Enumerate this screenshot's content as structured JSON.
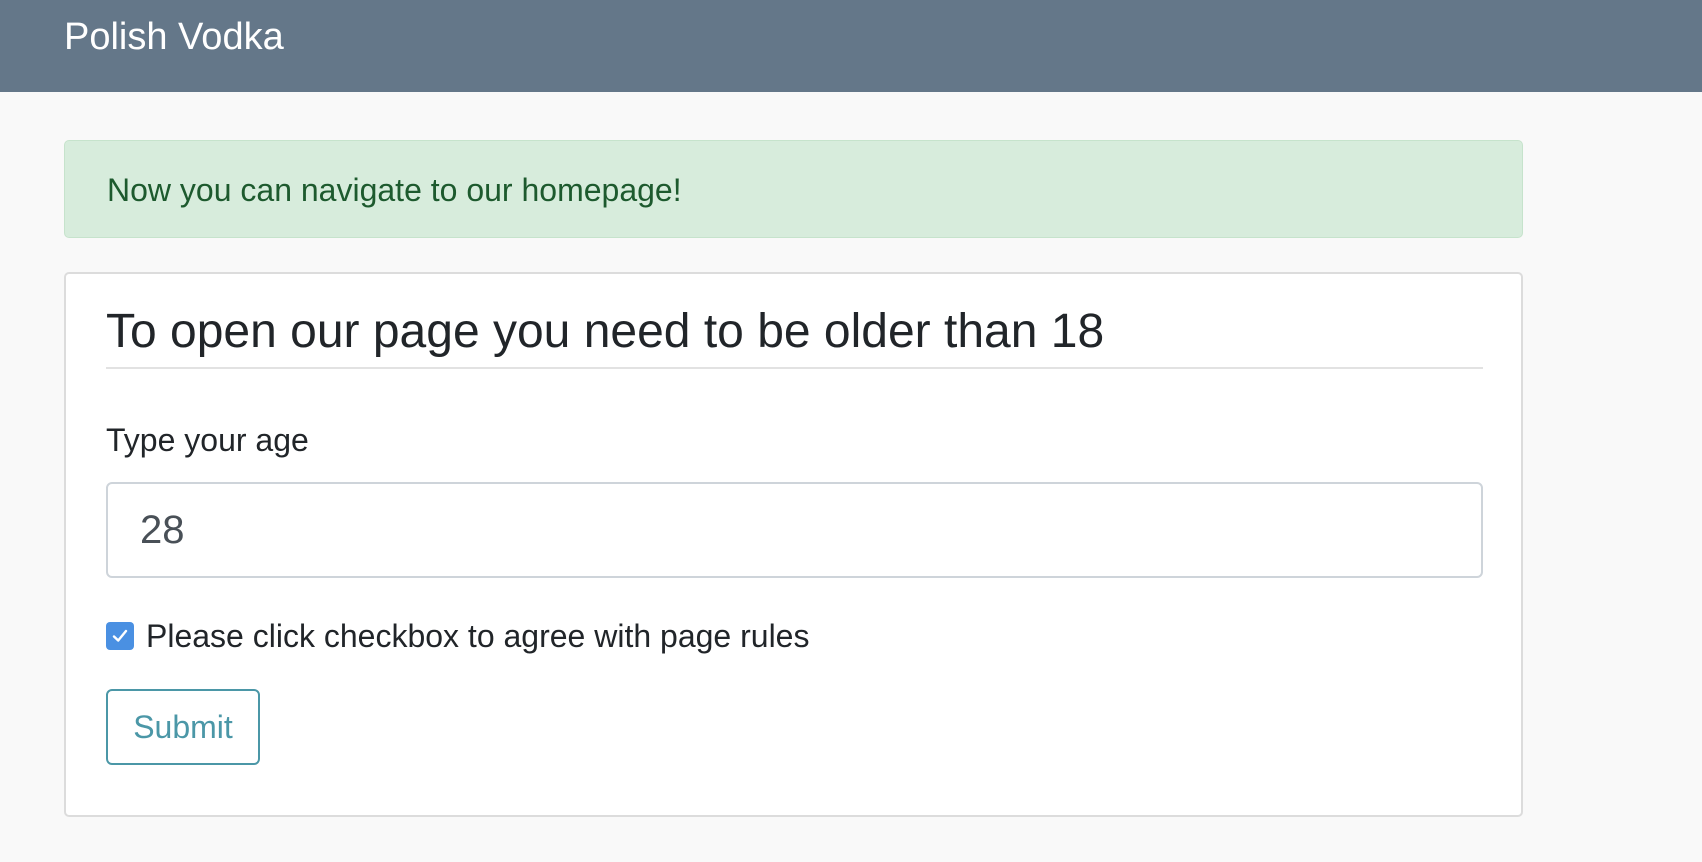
{
  "navbar": {
    "brand": "Polish Vodka"
  },
  "alert": {
    "message": "Now you can navigate to our homepage!"
  },
  "form": {
    "title": "To open our page you need to be older than 18",
    "age_label": "Type your age",
    "age_value": "28",
    "checkbox_checked": true,
    "checkbox_label": "Please click checkbox to agree with page rules",
    "submit_label": "Submit"
  },
  "colors": {
    "navbar_bg": "#647789",
    "alert_bg": "#d7ecdc",
    "alert_text": "#1d5a2e",
    "checkbox_accent": "#4a90e2",
    "button_outline": "#4b97a7"
  },
  "icons": {
    "checkbox": "check-icon"
  }
}
